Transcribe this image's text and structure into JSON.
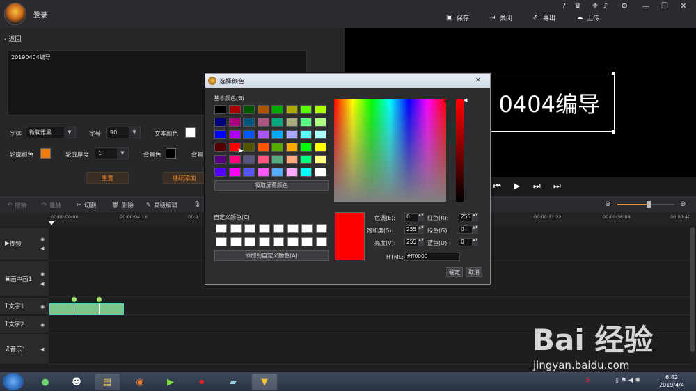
{
  "titlebar": {
    "user_label": "登录",
    "save": "保存",
    "close": "关闭",
    "export": "导出",
    "upload": "上传",
    "help": "?"
  },
  "left": {
    "back": "返回",
    "text_content": "20190404编导",
    "font_label": "字体",
    "font_value": "微软雅黑",
    "size_label": "字号",
    "size_value": "90",
    "text_color_label": "文本颜色",
    "outline_color_label": "轮廓颜色",
    "outline_width_label": "轮廓厚度",
    "outline_width_value": "1",
    "bg_color_label": "背景色",
    "bg_label2": "背景",
    "reset": "重置",
    "continue_add": "继续添加",
    "colors": {
      "text": "#ffffff",
      "outline": "#f07c10",
      "bg": "#000000"
    }
  },
  "preview": {
    "text": "0404编导"
  },
  "toolbar": {
    "undo": "撤销",
    "redo": "重做",
    "cut": "切割",
    "delete": "删除",
    "advanced": "高级编辑"
  },
  "zoom_level": 0.55,
  "ruler": [
    "00:00:00:00",
    "00:00:04:16",
    "00:0",
    "00:00:31:22",
    "00:00:36:08",
    "00:00:40"
  ],
  "tracks": [
    "视频",
    "画中画1",
    "文字1",
    "文字2",
    "音乐1"
  ],
  "dialog": {
    "title": "选择颜色",
    "basic_label": "基本颜色(B)",
    "pick_screen": "吸取屏幕颜色",
    "custom_label": "自定义颜色(C)",
    "add_custom": "添加到自定义颜色(A)",
    "hue_label": "色调(E):",
    "hue": "0",
    "sat_label": "饱和度(S):",
    "sat": "255",
    "lum_label": "亮度(V):",
    "lum": "255",
    "red_label": "红色(R):",
    "red": "255",
    "green_label": "绿色(G):",
    "green": "0",
    "blue_label": "蓝色(U):",
    "blue": "0",
    "html_label": "HTML:",
    "html": "#ff0000",
    "ok": "确定",
    "cancel": "取消",
    "current_color": "#ff0000",
    "basic_colors": [
      "#000000",
      "#aa0000",
      "#005500",
      "#aa5500",
      "#00aa00",
      "#aaaa00",
      "#55ff00",
      "#aaff00",
      "#00007f",
      "#aa007f",
      "#00557f",
      "#aa557f",
      "#00aa7f",
      "#aaaa7f",
      "#55ff7f",
      "#aaff7f",
      "#0000ff",
      "#aa00ff",
      "#0055ff",
      "#aa55ff",
      "#00aaff",
      "#aaaaff",
      "#55ffff",
      "#aaffff",
      "#550000",
      "#ff0000",
      "#555500",
      "#ff5500",
      "#55aa00",
      "#ffaa00",
      "#00ff00",
      "#ffff00",
      "#55007f",
      "#ff007f",
      "#55557f",
      "#ff557f",
      "#55aa7f",
      "#ffaa7f",
      "#00ff7f",
      "#ffff7f",
      "#5500ff",
      "#ff00ff",
      "#5555ff",
      "#ff55ff",
      "#55aaff",
      "#ffaaff",
      "#00ffff",
      "#ffffff"
    ]
  },
  "watermark": {
    "brand": "Bai 经验",
    "url": "jingyan.baidu.com"
  },
  "taskbar": {
    "time": "6:42",
    "date": "2019/4/4"
  }
}
